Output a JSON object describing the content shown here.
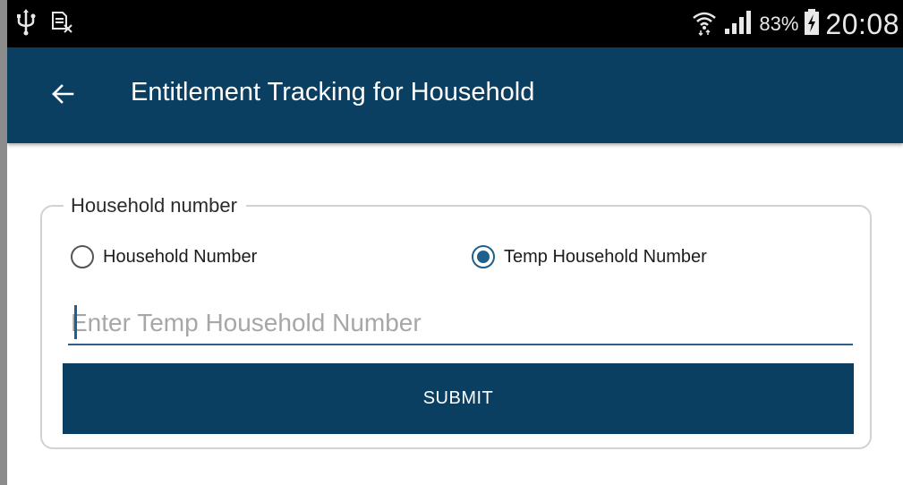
{
  "status_bar": {
    "left_icons": [
      "usb-icon",
      "no-sim-icon"
    ],
    "right_icons": [
      "wifi-icon",
      "signal-icon",
      "battery-charging-icon"
    ],
    "battery_percent": "83%",
    "time": "20:08"
  },
  "app_bar": {
    "back_icon": "back-arrow-icon",
    "title": "Entitlement Tracking for Household"
  },
  "form": {
    "legend": "Household number",
    "options": [
      {
        "label": "Household Number",
        "selected": false
      },
      {
        "label": "Temp Household Number",
        "selected": true
      }
    ],
    "input": {
      "value": "",
      "placeholder": "Enter Temp Household Number"
    },
    "submit_label": "SUBMIT"
  },
  "colors": {
    "primary": "#0b3f61",
    "accent": "#1f5f8e",
    "status_bar": "#000000",
    "background": "#ffffff"
  }
}
